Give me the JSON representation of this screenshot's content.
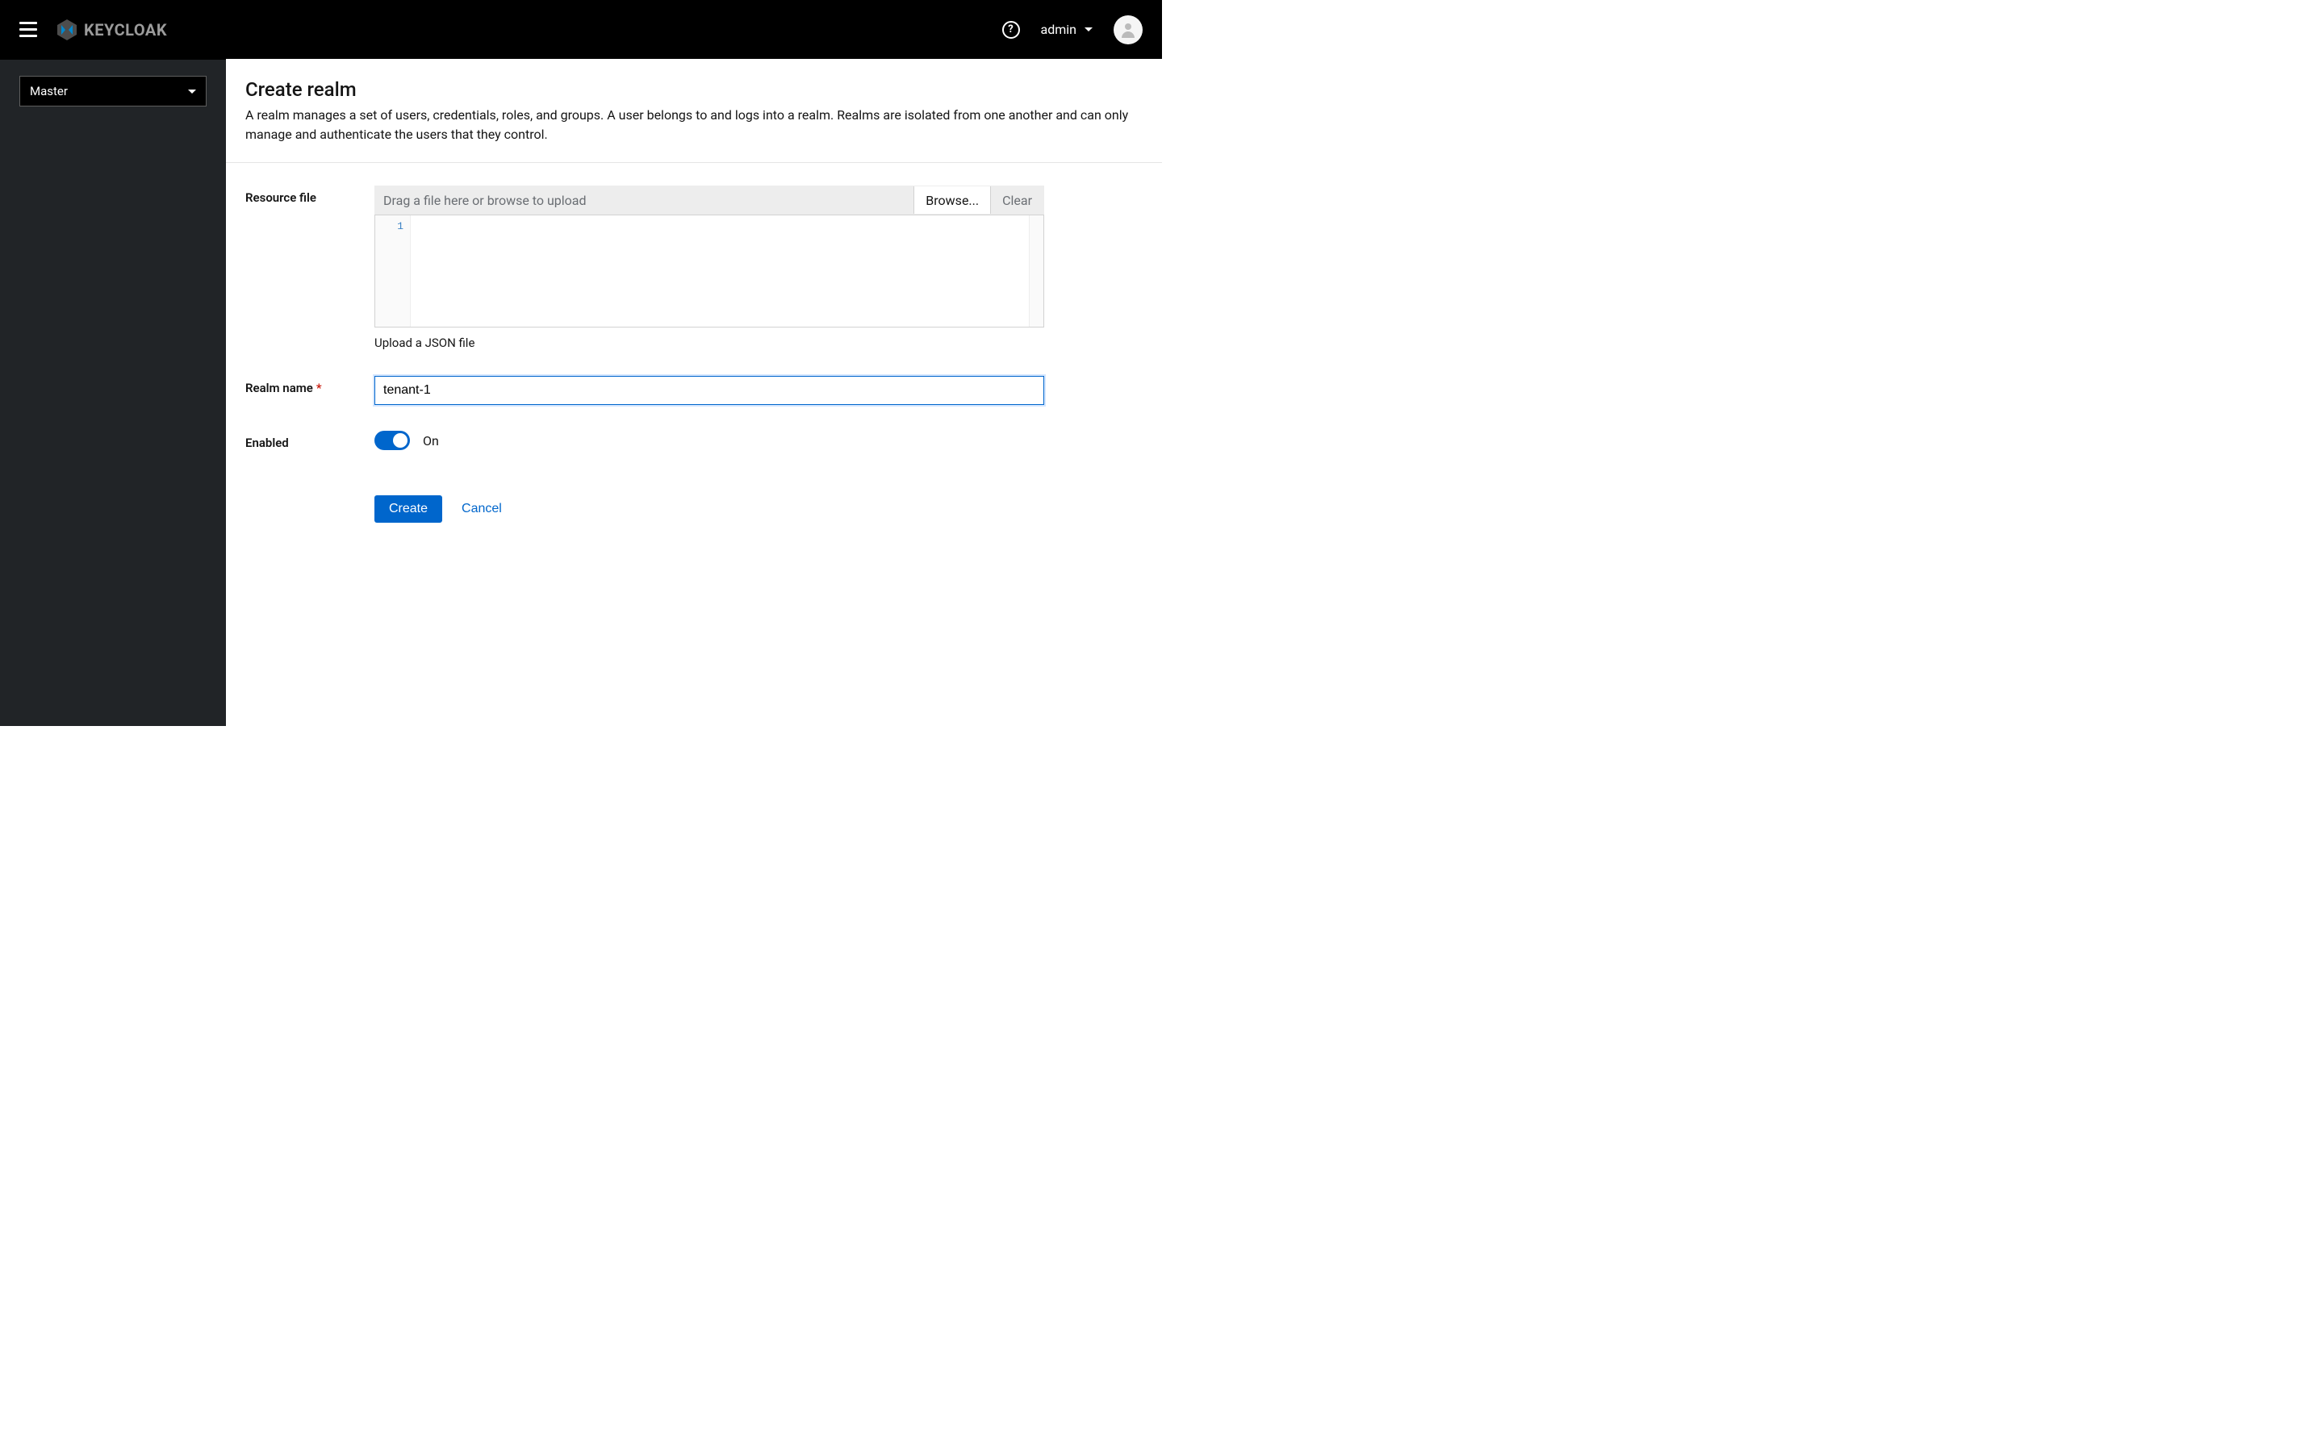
{
  "header": {
    "product_name": "KEYCLOAK",
    "user_name": "admin"
  },
  "sidebar": {
    "realm_selector": "Master"
  },
  "page": {
    "title": "Create realm",
    "description": "A realm manages a set of users, credentials, roles, and groups. A user belongs to and logs into a realm. Realms are isolated from one another and can only manage and authenticate the users that they control."
  },
  "form": {
    "resource_file": {
      "label": "Resource file",
      "placeholder": "Drag a file here or browse to upload",
      "browse_label": "Browse...",
      "clear_label": "Clear",
      "line_number": "1",
      "helper": "Upload a JSON file"
    },
    "realm_name": {
      "label": "Realm name",
      "value": "tenant-1"
    },
    "enabled": {
      "label": "Enabled",
      "state_label": "On"
    },
    "actions": {
      "create": "Create",
      "cancel": "Cancel"
    }
  }
}
